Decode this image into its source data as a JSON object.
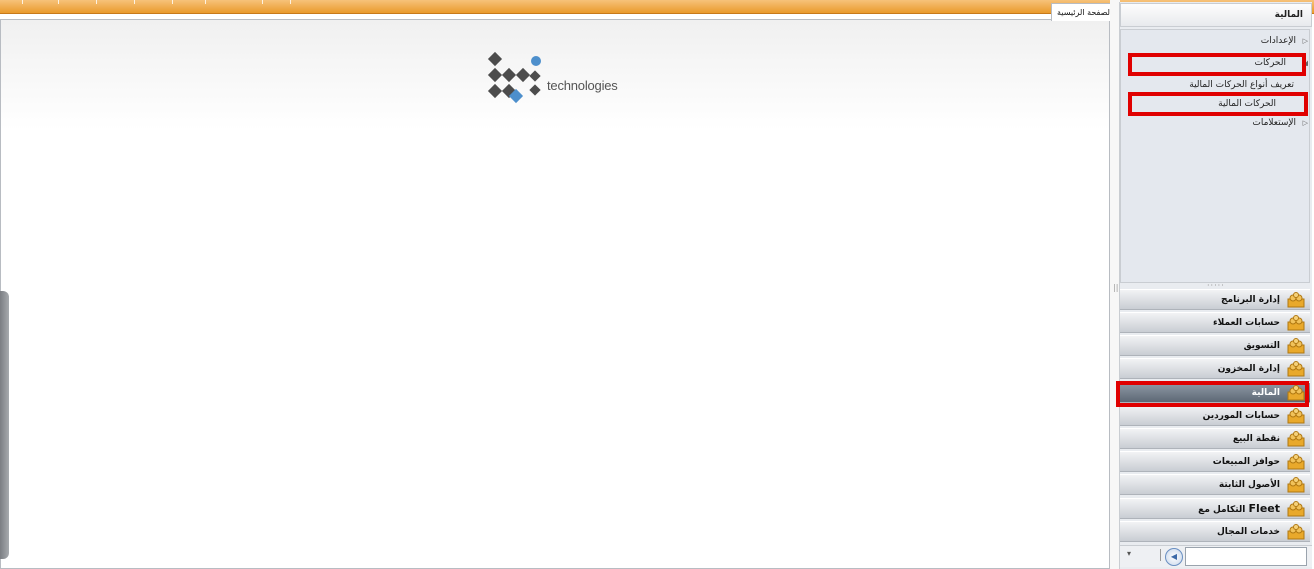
{
  "main": {
    "tab_label": "الصفحة الرئيسية",
    "logo_text": "technologies"
  },
  "nav": {
    "header": "المالية",
    "tree": [
      {
        "label": "الإعدادات",
        "expanded": false
      },
      {
        "label": "الحركات",
        "expanded": true
      },
      {
        "label": "تعريف أنواع الحركات المالية"
      },
      {
        "label": "الحركات المالية"
      },
      {
        "label": "الإستعلامات",
        "expanded": false
      }
    ],
    "modules": [
      {
        "label": "إدارة البرنامج",
        "icon": "users-folder-icon"
      },
      {
        "label": "حسابات العملاء",
        "icon": "users-folder-icon"
      },
      {
        "label": "التسويق",
        "icon": "users-folder-icon"
      },
      {
        "label": "إدارة المخزون",
        "icon": "users-folder-icon"
      },
      {
        "label": "المالية",
        "icon": "users-folder-icon",
        "active": true
      },
      {
        "label": "حسابات الموردين",
        "icon": "users-folder-icon"
      },
      {
        "label": "نقطة البيع",
        "icon": "users-folder-icon"
      },
      {
        "label": "حوافز المبيعات",
        "icon": "users-folder-icon"
      },
      {
        "label": "الأصول الثابتة",
        "icon": "users-folder-icon"
      },
      {
        "label_prefix": "التكامل مع",
        "label_brand": "Fleet",
        "icon": "users-folder-icon"
      },
      {
        "label": "خدمات المجال",
        "icon": "users-folder-icon"
      }
    ],
    "footer_dropdown_glyph": "▾",
    "footer_button_glyph": "◀",
    "search_value": ""
  },
  "colors": {
    "topbar": "#e99a2c",
    "highlight": "#e00000",
    "active_module": "#5d6875"
  }
}
